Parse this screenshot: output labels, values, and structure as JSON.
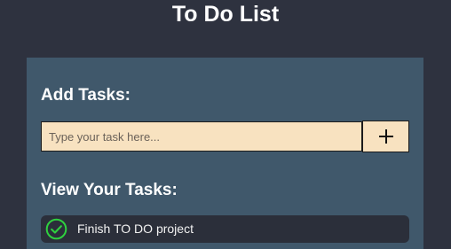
{
  "app": {
    "title": "To Do List"
  },
  "add_section": {
    "title": "Add Tasks:",
    "input_value": "",
    "input_placeholder": "Type your task here...",
    "add_button_icon": "plus-icon"
  },
  "view_section": {
    "title": "View Your Tasks:",
    "tasks": [
      {
        "text": "Finish TO DO project",
        "icon": "check-circle-icon"
      }
    ]
  },
  "colors": {
    "background": "#2e323f",
    "panel": "#40586b",
    "input_background": "#f8e2c0",
    "task_background": "#2b2f3a",
    "check_accent": "#2fd13f"
  }
}
